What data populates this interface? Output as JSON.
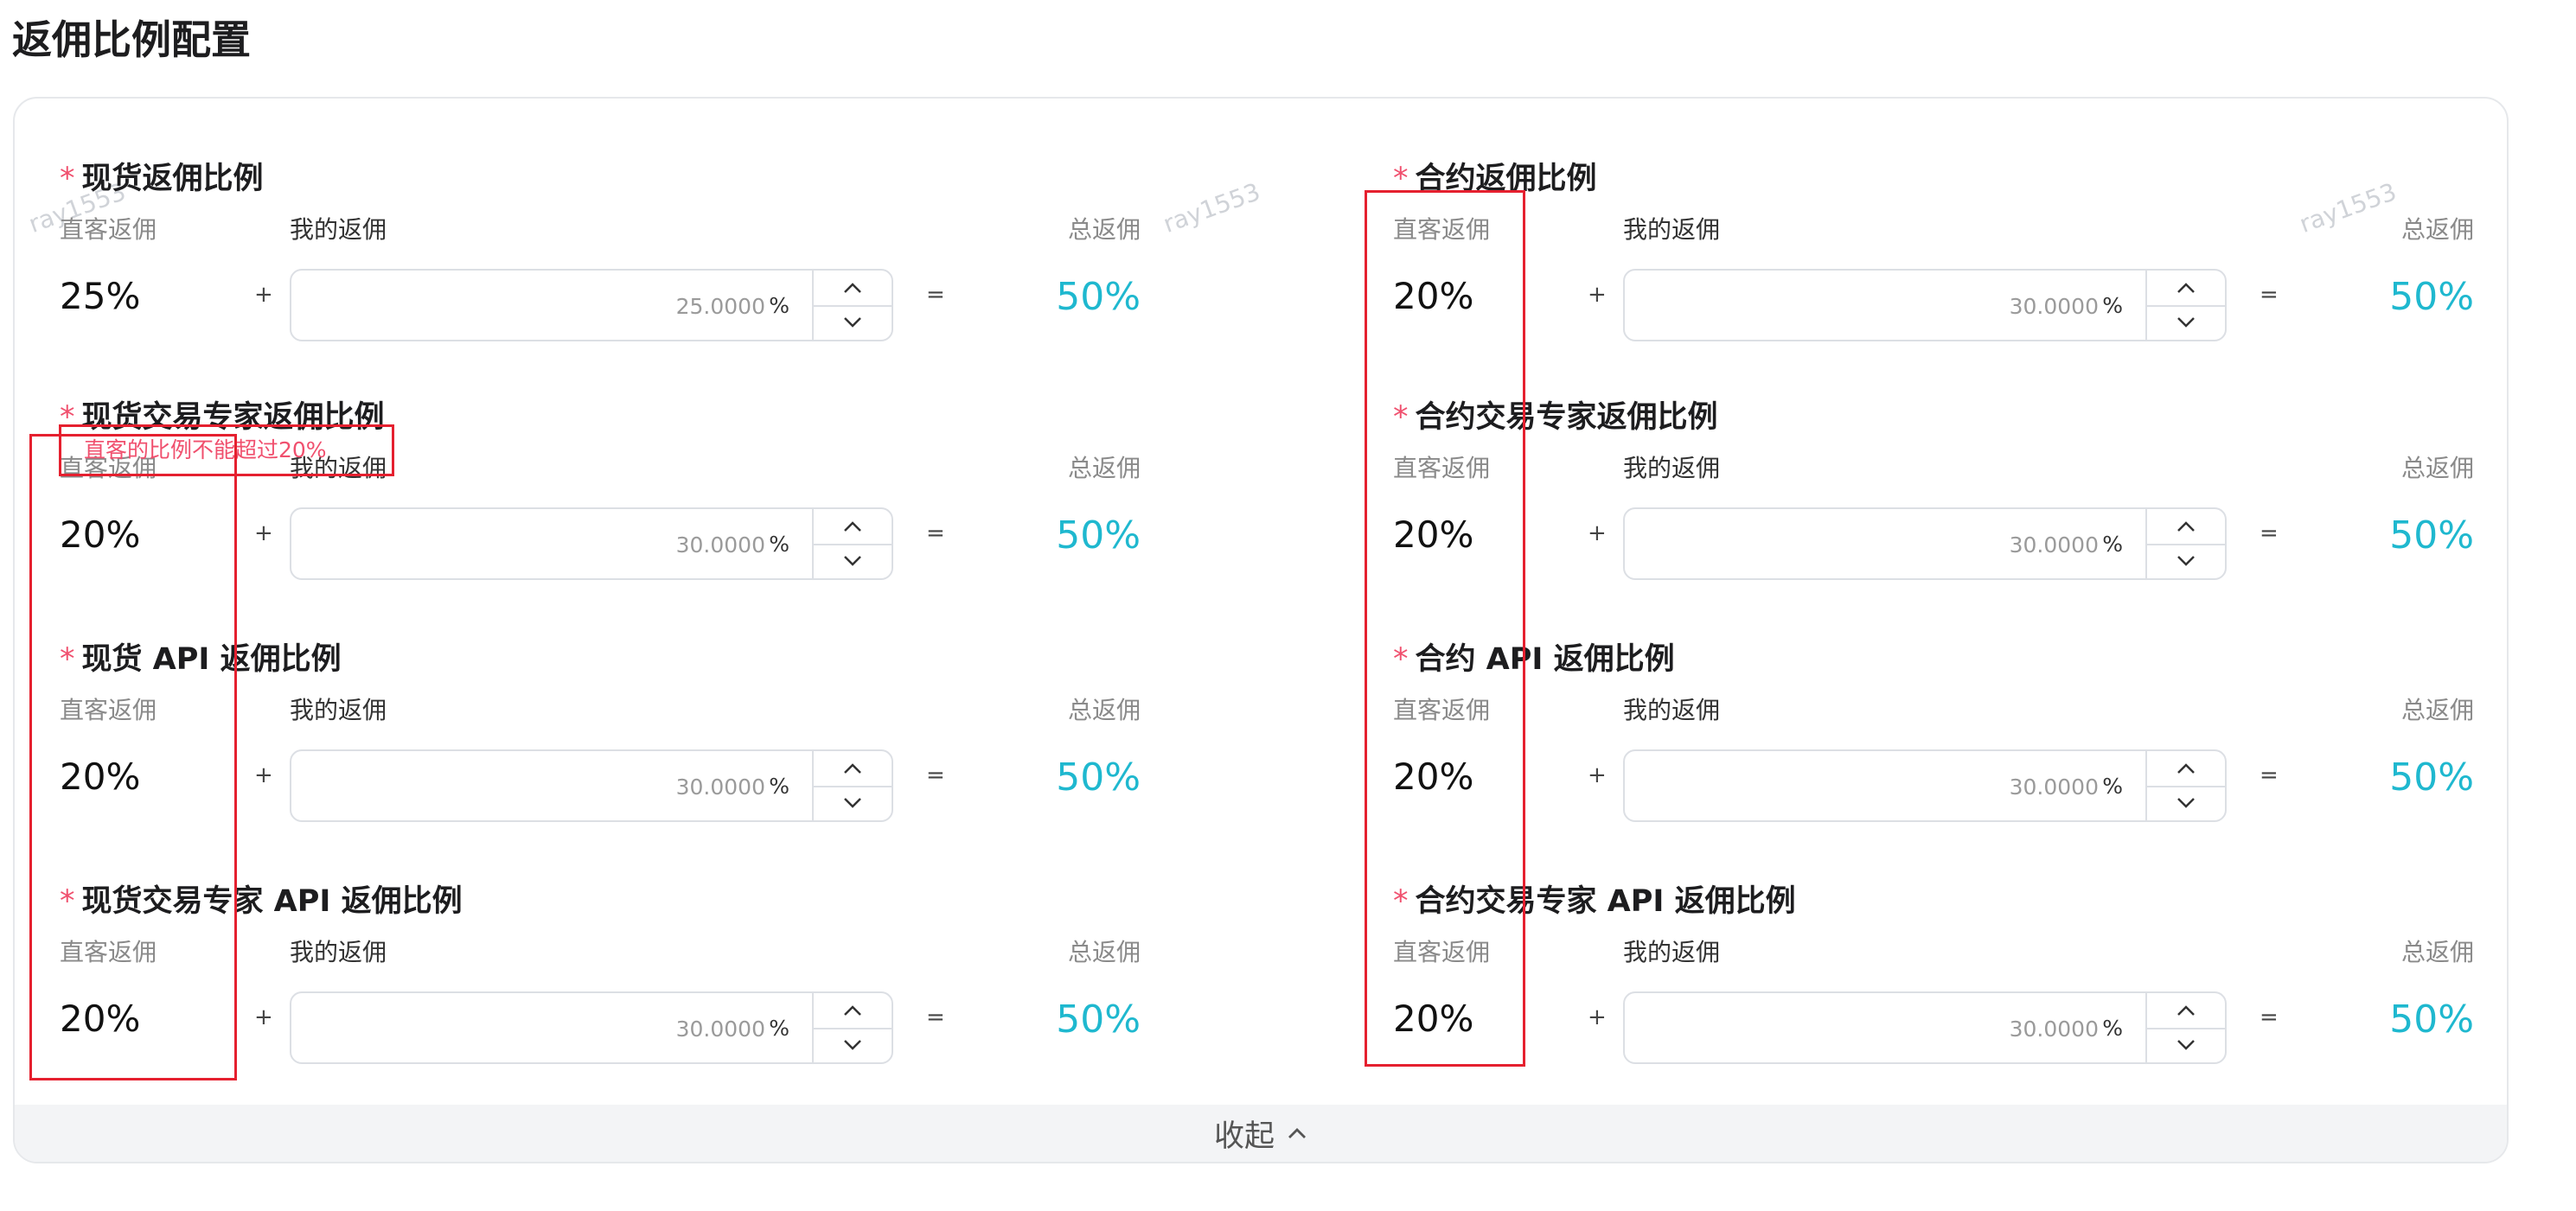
{
  "page": {
    "title": "返佣比例配置"
  },
  "labels": {
    "direct": "直客返佣",
    "mine": "我的返佣",
    "total": "总返佣",
    "unit": "%",
    "plus": "+",
    "equals": "=",
    "required": "*"
  },
  "watermark": "ray1553",
  "sections": [
    {
      "title": "现货返佣比例",
      "direct": "25%",
      "mine": "25.0000",
      "total": "50%",
      "error": "直客的比例不能超过20%"
    },
    {
      "title": "合约返佣比例",
      "direct": "20%",
      "mine": "30.0000",
      "total": "50%"
    },
    {
      "title": "现货交易专家返佣比例",
      "direct": "20%",
      "mine": "30.0000",
      "total": "50%"
    },
    {
      "title": "合约交易专家返佣比例",
      "direct": "20%",
      "mine": "30.0000",
      "total": "50%"
    },
    {
      "title": "现货 API 返佣比例",
      "direct": "20%",
      "mine": "30.0000",
      "total": "50%"
    },
    {
      "title": "合约 API 返佣比例",
      "direct": "20%",
      "mine": "30.0000",
      "total": "50%"
    },
    {
      "title": "现货交易专家 API 返佣比例",
      "direct": "20%",
      "mine": "30.0000",
      "total": "50%"
    },
    {
      "title": "合约交易专家 API 返佣比例",
      "direct": "20%",
      "mine": "30.0000",
      "total": "50%"
    }
  ],
  "collapse_label": "收起",
  "colors": {
    "accent": "#1fb8cf",
    "error": "#f0506e",
    "highlight": "#e5202f"
  },
  "icons": {
    "increment": "chevron-up-icon",
    "decrement": "chevron-down-icon",
    "collapse": "chevron-up-icon"
  }
}
